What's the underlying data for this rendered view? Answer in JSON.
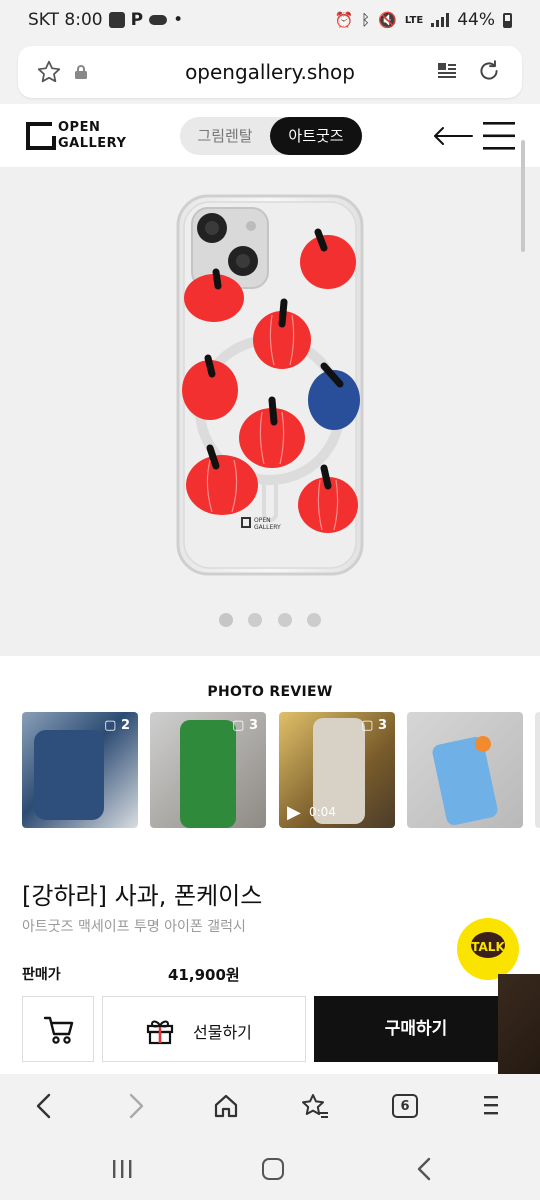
{
  "status": {
    "carrier_time": "SKT 8:00",
    "network": "LTE",
    "battery": "44%"
  },
  "browser": {
    "url": "opengallery.shop",
    "tabs_count": "6"
  },
  "header": {
    "logo_line1": "OPEN",
    "logo_line2": "GALLERY",
    "toggle_options": [
      "그림렌탈",
      "아트굿즈"
    ],
    "toggle_selected": "아트굿즈"
  },
  "hero": {
    "slides": 4,
    "active_slide": 1,
    "product_logo_line1": "OPEN",
    "product_logo_line2": "GALLERY"
  },
  "reviews": {
    "title": "PHOTO REVIEW",
    "items": [
      {
        "count": "2"
      },
      {
        "count": "3"
      },
      {
        "count": "3",
        "video_duration": "0:04"
      },
      {
        "count": ""
      }
    ]
  },
  "product": {
    "title": "[강하라] 사과, 폰케이스",
    "subtitle": "아트굿즈 맥세이프 투명 아이폰 갤럭시",
    "price_label": "판매가",
    "price": "41,900원"
  },
  "actions": {
    "gift_label": "선물하기",
    "buy_label": "구매하기"
  },
  "kakao": {
    "label": "TALK"
  },
  "colors": {
    "accent_dark": "#111111",
    "apple_red": "#f2302f",
    "apple_blue": "#2a4f9a",
    "kakao_yellow": "#fbe300"
  }
}
